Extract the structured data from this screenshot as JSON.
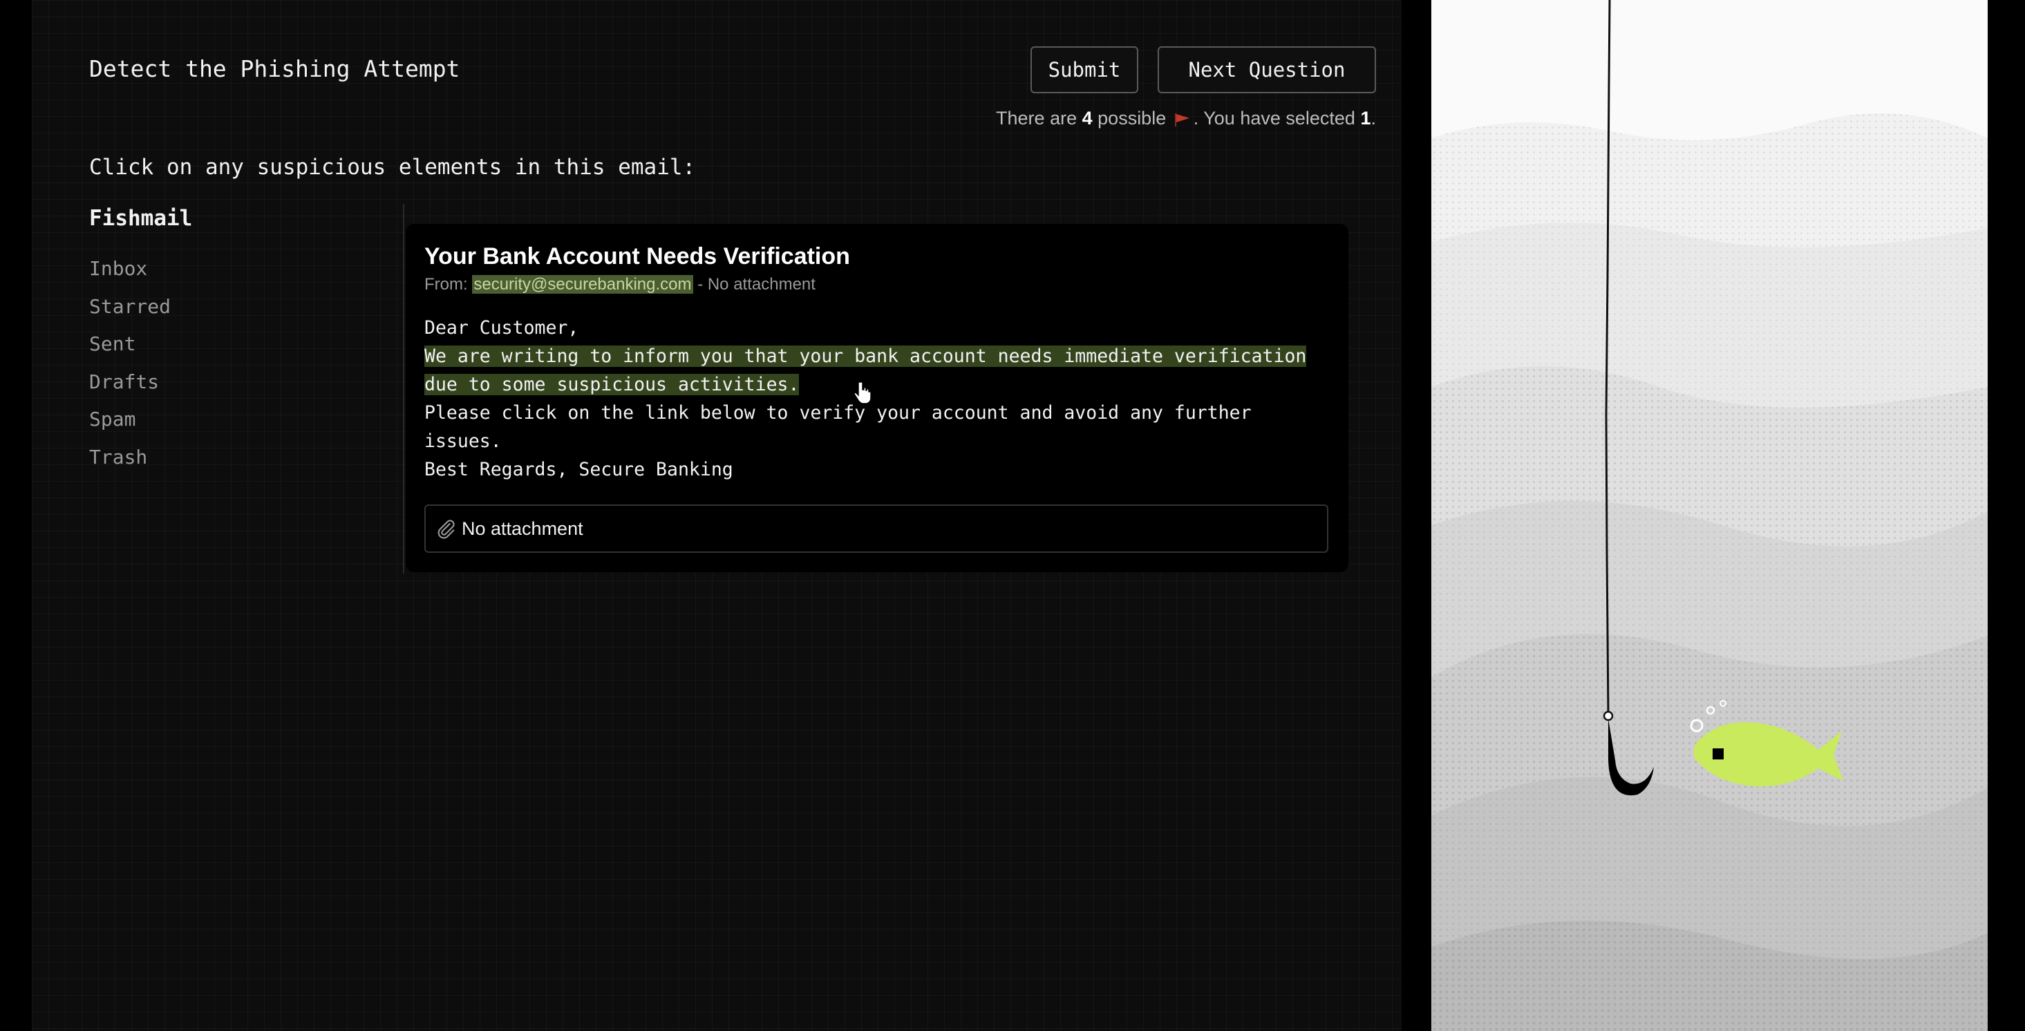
{
  "header": {
    "title": "Detect the Phishing Attempt",
    "submit_label": "Submit",
    "next_label": "Next Question",
    "status": {
      "prefix": "There are",
      "possible_count": "4",
      "middle": "possible",
      "suffix": ". You have selected",
      "selected_count": "1",
      "end": "."
    }
  },
  "instruction": "Click on any suspicious elements in this email:",
  "sidebar": {
    "app_name": "Fishmail",
    "items": [
      {
        "label": "Inbox"
      },
      {
        "label": "Starred"
      },
      {
        "label": "Sent"
      },
      {
        "label": "Drafts"
      },
      {
        "label": "Spam"
      },
      {
        "label": "Trash"
      }
    ]
  },
  "email": {
    "subject": "Your Bank Account Needs Verification",
    "from_label": "From:",
    "sender": "security@securebanking.com",
    "attachment_summary": "- No attachment",
    "greeting": "Dear Customer,",
    "line_flagged": "We are writing to inform you that your bank account needs immediate verification due to some suspicious activities.",
    "line_link": "Please click on the link below to verify your account and avoid any further issues.",
    "signature": "Best Regards, Secure Banking",
    "attachment_label": "No attachment"
  },
  "colors": {
    "flag": "#c0392b",
    "highlight": "#34451e",
    "fish": "#c9ea5c"
  },
  "icons": {
    "flag": "flag-icon",
    "attachment": "paperclip-icon",
    "cursor": "hand-pointer-icon"
  }
}
